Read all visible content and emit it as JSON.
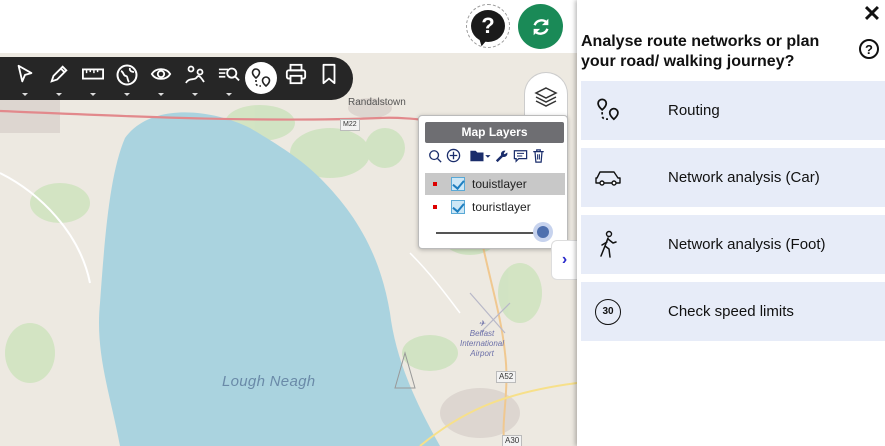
{
  "map": {
    "places": {
      "randalstown": "Randalstown"
    },
    "water": {
      "lough": "Lough Neagh"
    },
    "airport": "Belfast\nInternational\nAirport",
    "roads": {
      "a52": "A52",
      "a30": "A30",
      "m22": "M22"
    }
  },
  "topbar": {
    "help_icon": "question-bubble-icon",
    "refresh_icon": "refresh-icon",
    "refresh_color": "#1a8a57"
  },
  "toolbar": {
    "tools": [
      "pointer-icon",
      "draw-icon",
      "measure-icon",
      "globe-icon",
      "eye-icon",
      "route-sketch-icon",
      "search-map-icon",
      "routing-icon",
      "print-icon",
      "bookmark-icon"
    ],
    "active": "routing-icon"
  },
  "layers": {
    "title": "Map Layers",
    "items": [
      {
        "name": "touistlayer",
        "checked": true,
        "selected": true
      },
      {
        "name": "touristlayer",
        "checked": true,
        "selected": false
      }
    ],
    "opacity": 1.0
  },
  "panel": {
    "title": "Analyse route networks or plan your road/ walking journey?",
    "items": [
      {
        "label": "Routing",
        "icon": "routing-icon"
      },
      {
        "label": "Network analysis (Car)",
        "icon": "car-icon"
      },
      {
        "label": "Network analysis (Foot)",
        "icon": "walking-icon"
      },
      {
        "label": "Check speed limits",
        "icon": "speed-limit-icon",
        "icon_text": "30"
      }
    ],
    "item_bg": "#e7ecf8"
  }
}
